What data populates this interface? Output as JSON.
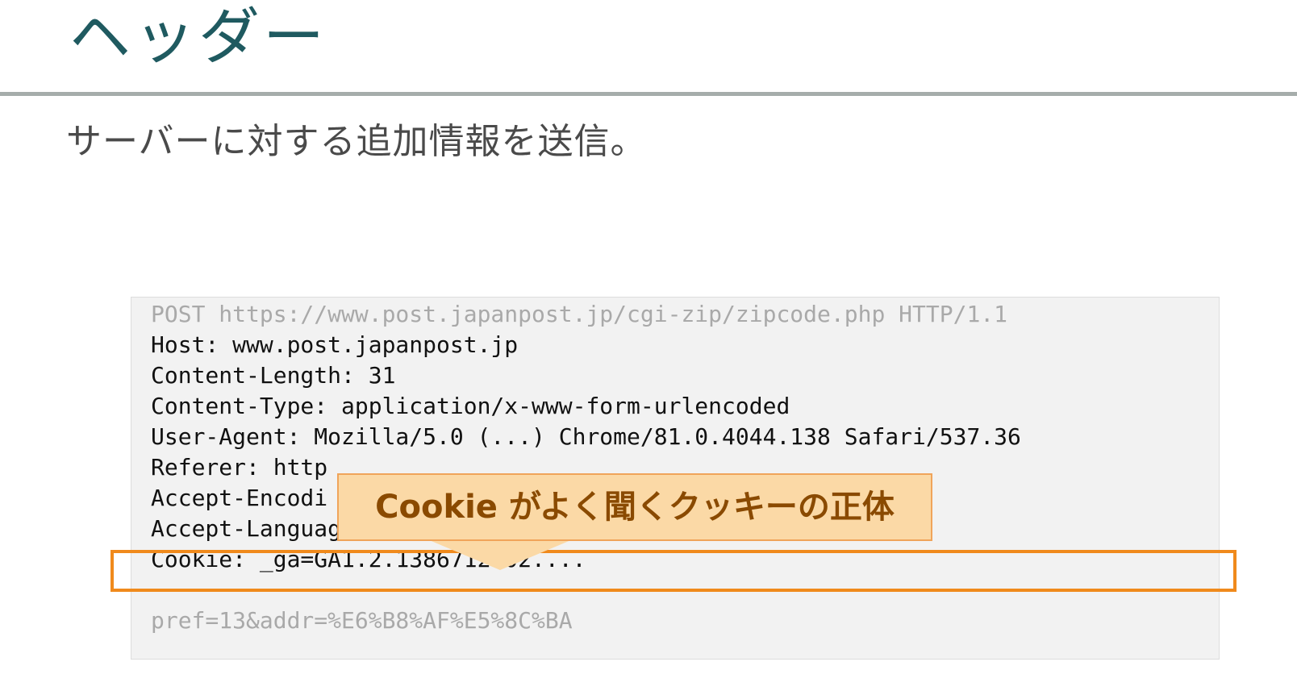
{
  "slide": {
    "title": "ヘッダー",
    "subtitle": "サーバーに対する追加情報を送信。"
  },
  "request": {
    "request_line": "POST https://www.post.japanpost.jp/cgi-zip/zipcode.php HTTP/1.1",
    "headers": [
      "Host: www.post.japanpost.jp",
      "Content-Length: 31",
      "Content-Type: application/x-www-form-urlencoded",
      "User-Agent: Mozilla/5.0 (...) Chrome/81.0.4044.138 Safari/537.36",
      "Referer: http",
      "Accept-Encodi",
      "Accept-Language:",
      "Cookie: _ga=GA1.2.1386712802...."
    ],
    "body": "pref=13&addr=%E6%B8%AF%E5%8C%BA"
  },
  "callout": {
    "text": "Cookie がよく聞くクッキーの正体"
  },
  "colors": {
    "title": "#1f5a60",
    "rule": "#a6adab",
    "highlight": "#f08a1c",
    "callout_fill": "#fbd9a6",
    "callout_text": "#8a4a00"
  }
}
